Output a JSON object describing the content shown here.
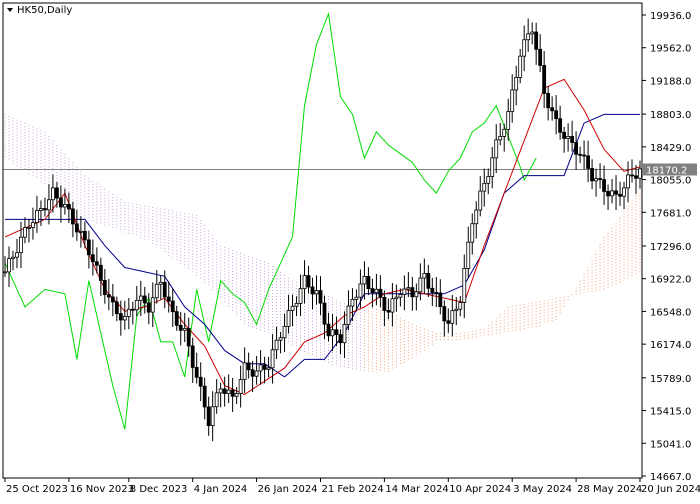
{
  "window": {
    "symbol_label": "HK50,Daily",
    "menu_arrow_icon": "triangle-down-icon"
  },
  "colors": {
    "background": "#ffffff",
    "candle": "#000000",
    "tenkan": "#cc0000",
    "kijun": "#00008b",
    "chikou": "#00dd00",
    "kumo_bullish": "#c9a0dc",
    "kumo_bearish": "#f0a070",
    "price_line": "#808080"
  },
  "chart_data": {
    "type": "candlestick",
    "instrument": "HK50",
    "timeframe": "Daily",
    "current_price": 18170.2,
    "current_price_label": "18170.2",
    "y_axis": {
      "ticks": [
        19936.0,
        19562.0,
        19188.0,
        18803.0,
        18429.0,
        18055.0,
        17681.0,
        17296.0,
        16922.0,
        16548.0,
        16174.0,
        15789.0,
        15415.0,
        15041.0,
        14667.0
      ],
      "tick_labels": [
        "19936.0",
        "19562.0",
        "19188.0",
        "18803.0",
        "18429.0",
        "18055.0",
        "17681.0",
        "17296.0",
        "16922.0",
        "16548.0",
        "16174.0",
        "15789.0",
        "15415.0",
        "15041.0",
        "14667.0"
      ],
      "ylim": [
        14600,
        20080
      ]
    },
    "x_axis": {
      "tick_labels": [
        "25 Oct 2023",
        "16 Nov 2023",
        "8 Dec 2023",
        "4 Jan 2024",
        "26 Jan 2024",
        "21 Feb 2024",
        "14 Mar 2024",
        "10 Apr 2024",
        "3 May 2024",
        "28 May 2024",
        "20 Jun 2024"
      ],
      "tick_bar_index": [
        0,
        16,
        31,
        47,
        63,
        79,
        95,
        111,
        127,
        143,
        159
      ]
    },
    "indicators": [
      "Ichimoku Kinko Hyo (Tenkan-sen, Kijun-sen, Senkou Span A/B cloud, Chikou Span)"
    ],
    "close_path": {
      "bar_index": [
        0,
        6,
        9,
        12,
        15,
        18,
        21,
        24,
        27,
        30,
        33,
        36,
        39,
        42,
        45,
        48,
        51,
        54,
        57,
        60,
        63,
        66,
        69,
        72,
        75,
        78,
        81,
        84,
        87,
        90,
        93,
        96,
        99,
        102,
        105,
        108,
        111,
        114,
        117,
        120,
        123,
        126,
        129,
        132,
        135,
        138,
        141,
        144,
        147,
        150,
        153,
        156,
        159
      ],
      "close": [
        17000,
        17550,
        17700,
        17900,
        17750,
        17500,
        17250,
        16900,
        16600,
        16450,
        16700,
        16600,
        16900,
        16500,
        16300,
        15800,
        15300,
        15700,
        15550,
        15900,
        15850,
        15950,
        16300,
        16600,
        16900,
        16750,
        16300,
        16250,
        16700,
        16900,
        16750,
        16550,
        16800,
        16750,
        16950,
        16700,
        16400,
        16700,
        17600,
        18000,
        18450,
        18800,
        19500,
        19800,
        19050,
        18700,
        18500,
        18350,
        18100,
        17950,
        17850,
        18050,
        18170
      ]
    },
    "tenkan_sen": {
      "bar_index": [
        0,
        5,
        10,
        15,
        20,
        25,
        30,
        35,
        40,
        45,
        50,
        55,
        60,
        65,
        70,
        75,
        80,
        85,
        90,
        95,
        100,
        105,
        110,
        115,
        120,
        125,
        130,
        135,
        140,
        145,
        150,
        155,
        159
      ],
      "value": [
        17400,
        17500,
        17600,
        17900,
        17300,
        16800,
        16550,
        16600,
        16700,
        16400,
        16150,
        15700,
        15600,
        15750,
        15900,
        16200,
        16300,
        16500,
        16600,
        16750,
        16800,
        16750,
        16700,
        16650,
        17300,
        17900,
        18500,
        19100,
        19200,
        18850,
        18400,
        18150,
        18200
      ]
    },
    "kijun_sen": {
      "bar_index": [
        0,
        5,
        10,
        15,
        20,
        25,
        30,
        35,
        40,
        45,
        50,
        55,
        60,
        65,
        70,
        75,
        80,
        85,
        90,
        95,
        100,
        105,
        110,
        115,
        120,
        125,
        130,
        135,
        140,
        145,
        150,
        155,
        159
      ],
      "value": [
        17600,
        17600,
        17600,
        17600,
        17600,
        17300,
        17050,
        17000,
        16950,
        16600,
        16400,
        16100,
        15950,
        15950,
        15800,
        16000,
        16000,
        16300,
        16750,
        16750,
        16750,
        16750,
        16750,
        16850,
        17250,
        17900,
        18100,
        18100,
        18100,
        18700,
        18800,
        18800,
        18800
      ]
    },
    "chikou_span": {
      "bar_index": [
        0,
        5,
        10,
        15,
        18,
        21,
        24,
        27,
        30,
        33,
        36,
        39,
        42,
        45,
        48,
        51,
        54,
        57,
        60,
        63,
        66,
        69,
        72,
        75,
        78,
        81,
        84,
        87,
        90,
        93,
        96,
        99,
        102,
        105,
        108,
        111,
        114,
        117,
        120,
        123,
        126,
        129,
        130,
        133
      ],
      "value": [
        17100,
        16600,
        16800,
        16750,
        16000,
        16900,
        16300,
        15700,
        15200,
        16500,
        16700,
        16200,
        16200,
        15800,
        16800,
        16200,
        16900,
        16750,
        16650,
        16400,
        16800,
        17100,
        17400,
        18900,
        19600,
        19950,
        19000,
        18800,
        18300,
        18600,
        18450,
        18350,
        18250,
        18050,
        17900,
        18150,
        18300,
        18600,
        18700,
        18900,
        18550,
        18200,
        18050,
        18300
      ]
    },
    "kumo_cloud": {
      "bar_index": [
        0,
        10,
        20,
        30,
        36,
        42,
        48,
        54,
        60,
        66,
        72,
        78,
        84,
        90,
        96,
        102,
        108,
        114,
        120,
        126,
        132,
        138,
        144,
        150,
        155,
        159
      ],
      "upper": [
        18800,
        18600,
        18100,
        17800,
        17750,
        17700,
        17650,
        17300,
        17200,
        17100,
        16900,
        16800,
        16650,
        16600,
        16550,
        16400,
        16300,
        16300,
        16350,
        16600,
        16650,
        16700,
        16750,
        16800,
        16900,
        17000
      ],
      "lower": [
        18300,
        18000,
        17600,
        17450,
        17350,
        17150,
        16950,
        16700,
        16400,
        16300,
        16150,
        16000,
        15900,
        15850,
        15850,
        16000,
        16200,
        16200,
        16250,
        16300,
        16350,
        16450,
        16900,
        17400,
        17700,
        17950
      ]
    }
  }
}
